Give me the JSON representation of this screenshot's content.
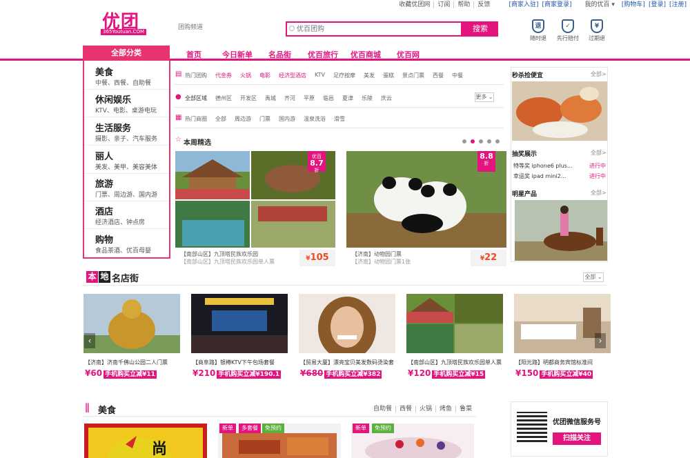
{
  "topbar": [
    "收藏优团网",
    "订阅",
    "帮助",
    "反馈",
    "[商家入驻]",
    "[商家登录]",
    "我的优百",
    "[购物车]",
    "[登录]",
    "[注册]"
  ],
  "logo": {
    "name": "优团",
    "url": "365Youtuan.COM"
  },
  "channel": "团购频道",
  "search": {
    "placeholder": "优百团购",
    "button": "搜索"
  },
  "features": [
    {
      "icon": "退",
      "label": "随时退"
    },
    {
      "icon": "✓",
      "label": "先行赔付"
    },
    {
      "icon": "¥",
      "label": "过期退"
    }
  ],
  "nav": {
    "category": "全部分类",
    "items": [
      "首页",
      "今日新单",
      "名品街",
      "优百旅行",
      "优百商城",
      "优百网"
    ]
  },
  "sidebar": [
    {
      "title": "美食",
      "sub": "中餐、西餐、自助餐"
    },
    {
      "title": "休闲娱乐",
      "sub": "KTV、电影、桌游电玩"
    },
    {
      "title": "生活服务",
      "sub": "摄影、亲子、汽车服务"
    },
    {
      "title": "丽人",
      "sub": "美发、美甲、美容美体"
    },
    {
      "title": "旅游",
      "sub": "门票、周边游、国内游"
    },
    {
      "title": "酒店",
      "sub": "经济酒店、钟点房"
    },
    {
      "title": "购物",
      "sub": "食品茶酒、优百母婴"
    }
  ],
  "filters": [
    {
      "icon": "hot-icon",
      "label": "热门团购",
      "items": [
        "代金券",
        "火锅",
        "电影",
        "经济型酒店",
        "KTV",
        "足疗按摩",
        "美发",
        "蛋糕",
        "景点门票",
        "西餐",
        "中餐"
      ],
      "hot": [
        0,
        1,
        2,
        3
      ]
    },
    {
      "icon": "location-icon",
      "label": "全部区域",
      "items": [
        "德州区",
        "开发区",
        "禹城",
        "齐河",
        "平原",
        "临邑",
        "夏津",
        "乐陵",
        "庆云"
      ],
      "hot": []
    },
    {
      "icon": "building-icon",
      "label": "热门商圈",
      "items": [
        "全部",
        "周边游",
        "门票",
        "国内游",
        "温泉洗浴",
        "滑雪"
      ],
      "hot": []
    }
  ],
  "more": "更多",
  "weekly": {
    "title": "本周精选",
    "deals": [
      {
        "name": "【南部山区】九顶塔民族欢乐园",
        "sub": "【南部山区】九顶塔民族欢乐园单人票",
        "price": "105",
        "discount": "8.7",
        "unit": "折",
        "brand": "优百"
      },
      {
        "name": "【济南】动物园门票",
        "sub": "【济南】动物园门票1张",
        "price": "22",
        "discount": "8.8",
        "unit": "折",
        "brand": ""
      }
    ]
  },
  "right": {
    "flash": {
      "title": "秒杀捡便宜",
      "all": "全部>"
    },
    "lottery": {
      "title": "抽奖展示",
      "all": "全部>",
      "items": [
        {
          "name": "特等奖 iphone6 plus...",
          "status": "进行中"
        },
        {
          "name": "幸运奖 ipad mini2...",
          "status": "进行中"
        }
      ]
    },
    "star": {
      "title": "明星产品",
      "all": "全部>"
    }
  },
  "shops": {
    "badge1": "本",
    "badge2": "地",
    "title": "名店街",
    "all": "全部",
    "items": [
      {
        "name": "【济南】济南千佛山公园二人门票",
        "price": "¥60",
        "promo": "手机购买立减¥11",
        "strike": false
      },
      {
        "name": "【商阜路】银樽KTV下午包场套餐",
        "price": "¥210",
        "promo": "手机购买立减¥190.1",
        "strike": false
      },
      {
        "name": "【贸易大厦】漂亮宝贝美发数码烫染套",
        "price": "¥680",
        "promo": "手机购买立减¥382",
        "strike": true
      },
      {
        "name": "【南部山区】九顶塔民族欢乐园单人票",
        "price": "¥120",
        "promo": "手机购买立减¥15",
        "strike": false
      },
      {
        "name": "【阳光路】明都商务宾馆标准间",
        "price": "¥150",
        "promo": "手机购买立减¥40",
        "strike": false
      }
    ]
  },
  "food": {
    "title": "美食",
    "tabs": [
      "自助餐",
      "西餐",
      "火锅",
      "烤鱼",
      "鲁菜"
    ],
    "tags1": [
      "新单",
      "多套餐",
      "免预约"
    ],
    "tags2": [
      "新单",
      "免预约"
    ],
    "logo_char": "尚"
  },
  "wechat": {
    "title": "优团微信服务号",
    "button": "扫描关注"
  },
  "colors": {
    "brand": "#e4147e",
    "price": "#f04a22",
    "promo": "#e4147e"
  }
}
